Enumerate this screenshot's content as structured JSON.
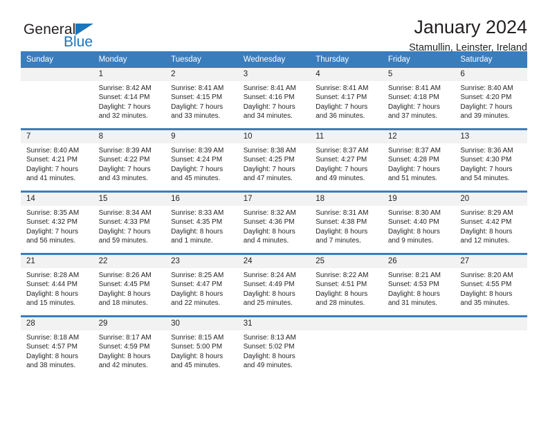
{
  "brand": {
    "name_dark": "General",
    "name_blue": "Blue",
    "accent_color": "#1b75bb"
  },
  "header": {
    "title": "January 2024",
    "subtitle": "Stamullin, Leinster, Ireland"
  },
  "colors": {
    "header_row": "#3a7dbd",
    "daynum_band": "#f2f2f2",
    "text": "#231f20"
  },
  "weekday_headers": [
    "Sunday",
    "Monday",
    "Tuesday",
    "Wednesday",
    "Thursday",
    "Friday",
    "Saturday"
  ],
  "labels": {
    "sunrise_prefix": "Sunrise: ",
    "sunset_prefix": "Sunset: ",
    "daylight_prefix": "Daylight: "
  },
  "weeks": [
    [
      {
        "day": "",
        "sunrise": "",
        "sunset": "",
        "daylight": ""
      },
      {
        "day": "1",
        "sunrise": "Sunrise: 8:42 AM",
        "sunset": "Sunset: 4:14 PM",
        "daylight": "Daylight: 7 hours and 32 minutes."
      },
      {
        "day": "2",
        "sunrise": "Sunrise: 8:41 AM",
        "sunset": "Sunset: 4:15 PM",
        "daylight": "Daylight: 7 hours and 33 minutes."
      },
      {
        "day": "3",
        "sunrise": "Sunrise: 8:41 AM",
        "sunset": "Sunset: 4:16 PM",
        "daylight": "Daylight: 7 hours and 34 minutes."
      },
      {
        "day": "4",
        "sunrise": "Sunrise: 8:41 AM",
        "sunset": "Sunset: 4:17 PM",
        "daylight": "Daylight: 7 hours and 36 minutes."
      },
      {
        "day": "5",
        "sunrise": "Sunrise: 8:41 AM",
        "sunset": "Sunset: 4:18 PM",
        "daylight": "Daylight: 7 hours and 37 minutes."
      },
      {
        "day": "6",
        "sunrise": "Sunrise: 8:40 AM",
        "sunset": "Sunset: 4:20 PM",
        "daylight": "Daylight: 7 hours and 39 minutes."
      }
    ],
    [
      {
        "day": "7",
        "sunrise": "Sunrise: 8:40 AM",
        "sunset": "Sunset: 4:21 PM",
        "daylight": "Daylight: 7 hours and 41 minutes."
      },
      {
        "day": "8",
        "sunrise": "Sunrise: 8:39 AM",
        "sunset": "Sunset: 4:22 PM",
        "daylight": "Daylight: 7 hours and 43 minutes."
      },
      {
        "day": "9",
        "sunrise": "Sunrise: 8:39 AM",
        "sunset": "Sunset: 4:24 PM",
        "daylight": "Daylight: 7 hours and 45 minutes."
      },
      {
        "day": "10",
        "sunrise": "Sunrise: 8:38 AM",
        "sunset": "Sunset: 4:25 PM",
        "daylight": "Daylight: 7 hours and 47 minutes."
      },
      {
        "day": "11",
        "sunrise": "Sunrise: 8:37 AM",
        "sunset": "Sunset: 4:27 PM",
        "daylight": "Daylight: 7 hours and 49 minutes."
      },
      {
        "day": "12",
        "sunrise": "Sunrise: 8:37 AM",
        "sunset": "Sunset: 4:28 PM",
        "daylight": "Daylight: 7 hours and 51 minutes."
      },
      {
        "day": "13",
        "sunrise": "Sunrise: 8:36 AM",
        "sunset": "Sunset: 4:30 PM",
        "daylight": "Daylight: 7 hours and 54 minutes."
      }
    ],
    [
      {
        "day": "14",
        "sunrise": "Sunrise: 8:35 AM",
        "sunset": "Sunset: 4:32 PM",
        "daylight": "Daylight: 7 hours and 56 minutes."
      },
      {
        "day": "15",
        "sunrise": "Sunrise: 8:34 AM",
        "sunset": "Sunset: 4:33 PM",
        "daylight": "Daylight: 7 hours and 59 minutes."
      },
      {
        "day": "16",
        "sunrise": "Sunrise: 8:33 AM",
        "sunset": "Sunset: 4:35 PM",
        "daylight": "Daylight: 8 hours and 1 minute."
      },
      {
        "day": "17",
        "sunrise": "Sunrise: 8:32 AM",
        "sunset": "Sunset: 4:36 PM",
        "daylight": "Daylight: 8 hours and 4 minutes."
      },
      {
        "day": "18",
        "sunrise": "Sunrise: 8:31 AM",
        "sunset": "Sunset: 4:38 PM",
        "daylight": "Daylight: 8 hours and 7 minutes."
      },
      {
        "day": "19",
        "sunrise": "Sunrise: 8:30 AM",
        "sunset": "Sunset: 4:40 PM",
        "daylight": "Daylight: 8 hours and 9 minutes."
      },
      {
        "day": "20",
        "sunrise": "Sunrise: 8:29 AM",
        "sunset": "Sunset: 4:42 PM",
        "daylight": "Daylight: 8 hours and 12 minutes."
      }
    ],
    [
      {
        "day": "21",
        "sunrise": "Sunrise: 8:28 AM",
        "sunset": "Sunset: 4:44 PM",
        "daylight": "Daylight: 8 hours and 15 minutes."
      },
      {
        "day": "22",
        "sunrise": "Sunrise: 8:26 AM",
        "sunset": "Sunset: 4:45 PM",
        "daylight": "Daylight: 8 hours and 18 minutes."
      },
      {
        "day": "23",
        "sunrise": "Sunrise: 8:25 AM",
        "sunset": "Sunset: 4:47 PM",
        "daylight": "Daylight: 8 hours and 22 minutes."
      },
      {
        "day": "24",
        "sunrise": "Sunrise: 8:24 AM",
        "sunset": "Sunset: 4:49 PM",
        "daylight": "Daylight: 8 hours and 25 minutes."
      },
      {
        "day": "25",
        "sunrise": "Sunrise: 8:22 AM",
        "sunset": "Sunset: 4:51 PM",
        "daylight": "Daylight: 8 hours and 28 minutes."
      },
      {
        "day": "26",
        "sunrise": "Sunrise: 8:21 AM",
        "sunset": "Sunset: 4:53 PM",
        "daylight": "Daylight: 8 hours and 31 minutes."
      },
      {
        "day": "27",
        "sunrise": "Sunrise: 8:20 AM",
        "sunset": "Sunset: 4:55 PM",
        "daylight": "Daylight: 8 hours and 35 minutes."
      }
    ],
    [
      {
        "day": "28",
        "sunrise": "Sunrise: 8:18 AM",
        "sunset": "Sunset: 4:57 PM",
        "daylight": "Daylight: 8 hours and 38 minutes."
      },
      {
        "day": "29",
        "sunrise": "Sunrise: 8:17 AM",
        "sunset": "Sunset: 4:59 PM",
        "daylight": "Daylight: 8 hours and 42 minutes."
      },
      {
        "day": "30",
        "sunrise": "Sunrise: 8:15 AM",
        "sunset": "Sunset: 5:00 PM",
        "daylight": "Daylight: 8 hours and 45 minutes."
      },
      {
        "day": "31",
        "sunrise": "Sunrise: 8:13 AM",
        "sunset": "Sunset: 5:02 PM",
        "daylight": "Daylight: 8 hours and 49 minutes."
      },
      {
        "day": "",
        "sunrise": "",
        "sunset": "",
        "daylight": ""
      },
      {
        "day": "",
        "sunrise": "",
        "sunset": "",
        "daylight": ""
      },
      {
        "day": "",
        "sunrise": "",
        "sunset": "",
        "daylight": ""
      }
    ]
  ]
}
